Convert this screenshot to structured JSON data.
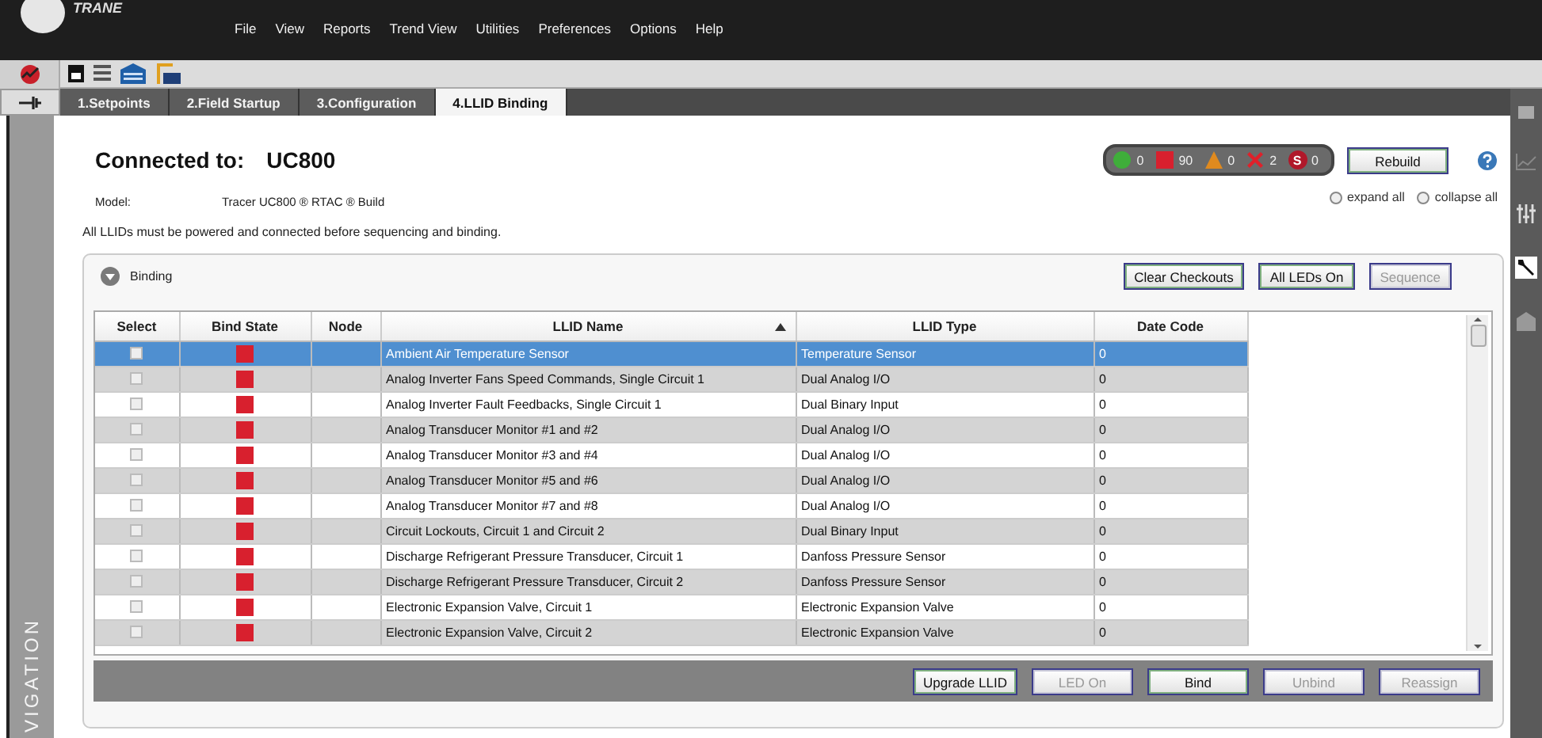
{
  "app": {
    "logo": "TRANE"
  },
  "menu": [
    "File",
    "View",
    "Reports",
    "Trend View",
    "Utilities",
    "Preferences",
    "Options",
    "Help"
  ],
  "tabs": [
    {
      "label": "1.Setpoints",
      "selected": false
    },
    {
      "label": "2.Field Startup",
      "selected": false
    },
    {
      "label": "3.Configuration",
      "selected": false
    },
    {
      "label": "4.LLID Binding",
      "selected": true
    }
  ],
  "navigation": {
    "label": "VIGATION"
  },
  "header": {
    "connected_label": "Connected to:",
    "device": "UC800",
    "model_label": "Model:",
    "model": "Tracer UC800 ® RTAC ® Build",
    "note": "All LLIDs must be powered and connected before sequencing and binding."
  },
  "status_counts": [
    {
      "kind": "ok",
      "count": "0",
      "color": "#3fae3a"
    },
    {
      "kind": "unbound",
      "count": "90",
      "color": "#d8202e"
    },
    {
      "kind": "warning",
      "count": "0",
      "color": "#e08a1e"
    },
    {
      "kind": "error",
      "count": "2",
      "color": "#e0202a"
    },
    {
      "kind": "stop",
      "symbol": "S",
      "count": "0",
      "color": "#b0182a"
    }
  ],
  "rebuild_button": {
    "label": "Rebuild",
    "disabled": false
  },
  "radios": [
    {
      "label": "expand all",
      "selected": false
    },
    {
      "label": "collapse all",
      "selected": false
    }
  ],
  "binding": {
    "title": "Binding",
    "expanded": true,
    "buttons": [
      {
        "label": "Clear Checkouts",
        "disabled": false
      },
      {
        "label": "All LEDs On",
        "disabled": false
      },
      {
        "label": "Sequence",
        "disabled": true
      }
    ],
    "table": {
      "columns": [
        "Select",
        "Bind State",
        "Node",
        "LLID Name",
        "LLID Type",
        "Date Code"
      ],
      "rows": [
        {
          "checked": false,
          "bound": false,
          "node": "",
          "name": "Ambient Air Temperature Sensor",
          "type": "Temperature Sensor",
          "date_code": "0",
          "selected": true
        },
        {
          "checked": false,
          "bound": false,
          "node": "",
          "name": "Analog Inverter Fans Speed Commands, Single Circuit 1",
          "type": "Dual Analog I/O",
          "date_code": "0",
          "selected": false
        },
        {
          "checked": false,
          "bound": false,
          "node": "",
          "name": "Analog Inverter Fault Feedbacks, Single Circuit 1",
          "type": "Dual Binary Input",
          "date_code": "0",
          "selected": false
        },
        {
          "checked": false,
          "bound": false,
          "node": "",
          "name": "Analog Transducer Monitor #1 and #2",
          "type": "Dual Analog I/O",
          "date_code": "0",
          "selected": false
        },
        {
          "checked": false,
          "bound": false,
          "node": "",
          "name": "Analog Transducer Monitor #3 and #4",
          "type": "Dual Analog I/O",
          "date_code": "0",
          "selected": false
        },
        {
          "checked": false,
          "bound": false,
          "node": "",
          "name": "Analog Transducer Monitor #5 and #6",
          "type": "Dual Analog I/O",
          "date_code": "0",
          "selected": false
        },
        {
          "checked": false,
          "bound": false,
          "node": "",
          "name": "Analog Transducer Monitor #7 and #8",
          "type": "Dual Analog I/O",
          "date_code": "0",
          "selected": false
        },
        {
          "checked": false,
          "bound": false,
          "node": "",
          "name": "Circuit Lockouts, Circuit 1 and Circuit 2",
          "type": "Dual Binary Input",
          "date_code": "0",
          "selected": false
        },
        {
          "checked": false,
          "bound": false,
          "node": "",
          "name": "Discharge Refrigerant Pressure Transducer, Circuit 1",
          "type": "Danfoss Pressure Sensor",
          "date_code": "0",
          "selected": false
        },
        {
          "checked": false,
          "bound": false,
          "node": "",
          "name": "Discharge Refrigerant Pressure Transducer, Circuit 2",
          "type": "Danfoss Pressure Sensor",
          "date_code": "0",
          "selected": false
        },
        {
          "checked": false,
          "bound": false,
          "node": "",
          "name": "Electronic Expansion Valve, Circuit 1",
          "type": "Electronic Expansion Valve",
          "date_code": "0",
          "selected": false
        },
        {
          "checked": false,
          "bound": false,
          "node": "",
          "name": "Electronic Expansion Valve, Circuit 2",
          "type": "Electronic Expansion Valve",
          "date_code": "0",
          "selected": false
        }
      ]
    },
    "footer_buttons": [
      {
        "label": "Upgrade LLID",
        "disabled": false
      },
      {
        "label": "LED On",
        "disabled": true
      },
      {
        "label": "Bind",
        "disabled": false
      },
      {
        "label": "Unbind",
        "disabled": true
      },
      {
        "label": "Reassign",
        "disabled": true
      }
    ]
  }
}
